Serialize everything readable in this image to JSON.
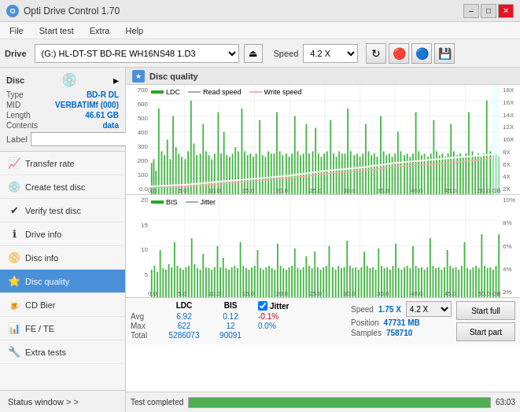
{
  "titlebar": {
    "title": "Opti Drive Control 1.70",
    "icon": "O",
    "minimize": "–",
    "maximize": "□",
    "close": "✕"
  },
  "menubar": {
    "items": [
      "File",
      "Start test",
      "Extra",
      "Help"
    ]
  },
  "drivebar": {
    "drive_label": "Drive",
    "drive_value": "(G:) HL-DT-ST BD-RE  WH16NS48 1.D3",
    "speed_label": "Speed",
    "speed_value": "4.2 X"
  },
  "disc_panel": {
    "label": "Disc",
    "type_key": "Type",
    "type_val": "BD-R DL",
    "mid_key": "MID",
    "mid_val": "VERBATIMf (000)",
    "length_key": "Length",
    "length_val": "46.61 GB",
    "contents_key": "Contents",
    "contents_val": "data",
    "label_key": "Label"
  },
  "nav": {
    "items": [
      {
        "id": "transfer-rate",
        "label": "Transfer rate",
        "icon": "📈",
        "active": false
      },
      {
        "id": "create-test-disc",
        "label": "Create test disc",
        "icon": "💿",
        "active": false
      },
      {
        "id": "verify-test-disc",
        "label": "Verify test disc",
        "icon": "✔",
        "active": false
      },
      {
        "id": "drive-info",
        "label": "Drive info",
        "icon": "ℹ",
        "active": false
      },
      {
        "id": "disc-info",
        "label": "Disc info",
        "icon": "📀",
        "active": false
      },
      {
        "id": "disc-quality",
        "label": "Disc quality",
        "icon": "⭐",
        "active": true
      },
      {
        "id": "cd-bier",
        "label": "CD Bier",
        "icon": "🍺",
        "active": false
      },
      {
        "id": "fe-te",
        "label": "FE / TE",
        "icon": "📊",
        "active": false
      },
      {
        "id": "extra-tests",
        "label": "Extra tests",
        "icon": "🔧",
        "active": false
      }
    ],
    "status_window": "Status window > >"
  },
  "content": {
    "title": "Disc quality",
    "legend_top": {
      "ldc": "LDC",
      "read_speed": "Read speed",
      "write_speed": "Write speed"
    },
    "legend_bottom": {
      "bis": "BIS",
      "jitter": "Jitter"
    },
    "y_top_left": [
      "700",
      "600",
      "500",
      "400",
      "300",
      "200",
      "100",
      "0.0"
    ],
    "y_top_right": [
      "18X",
      "16X",
      "14X",
      "12X",
      "10X",
      "8X",
      "6X",
      "4X",
      "2X"
    ],
    "x_labels": [
      "0.0",
      "5.0",
      "10.0",
      "15.0",
      "20.0",
      "25.0",
      "30.0",
      "35.0",
      "40.0",
      "45.0",
      "50.0 GB"
    ],
    "y_bottom_left": [
      "20",
      "15",
      "10",
      "5"
    ],
    "y_bottom_right": [
      "10%",
      "8%",
      "6%",
      "4%",
      "2%"
    ]
  },
  "stats": {
    "headers": [
      "LDC",
      "BIS",
      "",
      "Jitter",
      "Speed",
      "1.75 X",
      "",
      "4.2 X"
    ],
    "jitter_check": "Jitter",
    "speed_label": "Speed",
    "speed_val": "1.75 X",
    "speed_select": "4.2 X",
    "position_label": "Position",
    "position_val": "47731 MB",
    "samples_label": "Samples",
    "samples_val": "758710",
    "rows": [
      {
        "label": "Avg",
        "ldc": "6.92",
        "bis": "0.12",
        "jitter": "-0.1%"
      },
      {
        "label": "Max",
        "ldc": "622",
        "bis": "12",
        "jitter": "0.0%"
      },
      {
        "label": "Total",
        "ldc": "5286073",
        "bis": "90091",
        "jitter": ""
      }
    ],
    "start_full": "Start full",
    "start_part": "Start part"
  },
  "statusbar": {
    "text": "Test completed",
    "progress": 100,
    "number": "63:03"
  }
}
